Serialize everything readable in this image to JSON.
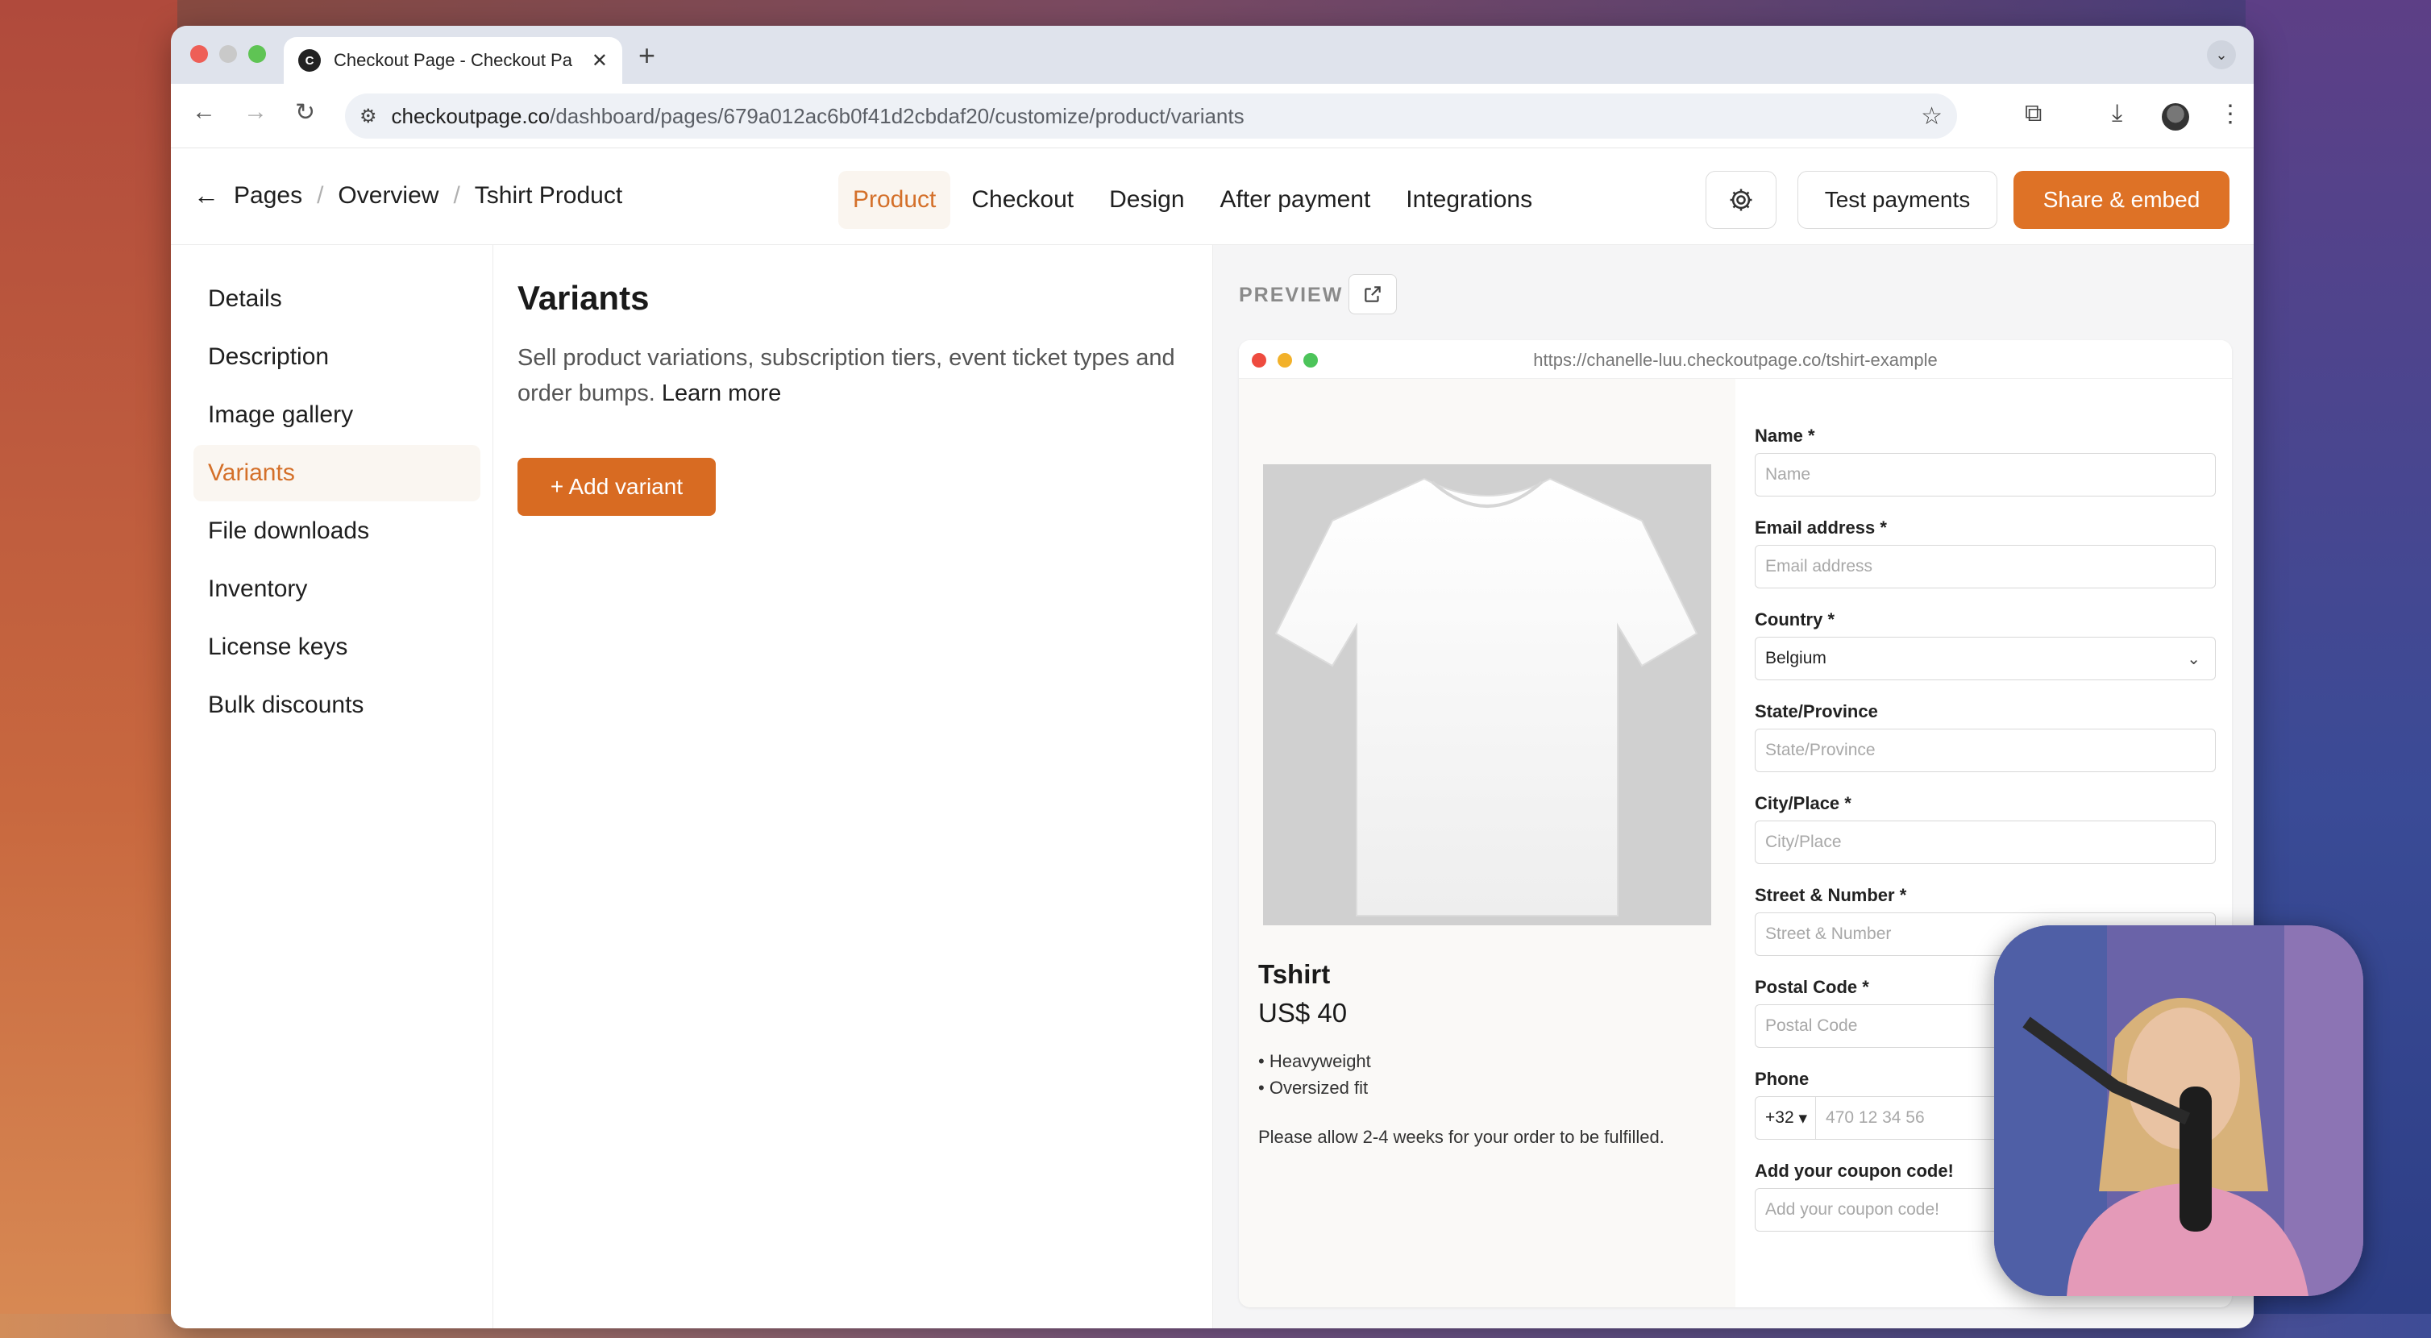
{
  "browser": {
    "tab_title": "Checkout Page - Checkout Pa",
    "tab_favicon": "C",
    "url_domain": "checkoutpage.co",
    "url_path": "/dashboard/pages/679a012ac6b0f41d2cbdaf20/customize/product/variants"
  },
  "header": {
    "breadcrumbs": [
      "Pages",
      "Overview",
      "Tshirt Product"
    ],
    "tabs": [
      "Product",
      "Checkout",
      "Design",
      "After payment",
      "Integrations"
    ],
    "active_tab": "Product",
    "test_payments": "Test payments",
    "share_embed": "Share & embed",
    "accent": "#de7226"
  },
  "sidebar": {
    "items": [
      "Details",
      "Description",
      "Image gallery",
      "Variants",
      "File downloads",
      "Inventory",
      "License keys",
      "Bulk discounts"
    ],
    "active": "Variants"
  },
  "main": {
    "title": "Variants",
    "description": "Sell product variations, subscription tiers, event ticket types and order bumps.",
    "learn_more": "Learn more",
    "add_variant": "+ Add variant"
  },
  "preview": {
    "label": "PREVIEW",
    "url": "https://chanelle-luu.checkoutpage.co/tshirt-example",
    "product": {
      "name": "Tshirt",
      "price": "US$ 40",
      "bullets": [
        "Heavyweight",
        "Oversized fit"
      ],
      "note": "Please allow 2-4 weeks for your order to be fulfilled."
    },
    "form": {
      "name_label": "Name",
      "name_placeholder": "Name",
      "email_label": "Email address",
      "email_placeholder": "Email address",
      "country_label": "Country",
      "country_value": "Belgium",
      "state_label": "State/Province",
      "state_placeholder": "State/Province",
      "city_label": "City/Place",
      "city_placeholder": "City/Place",
      "street_label": "Street & Number",
      "street_placeholder": "Street & Number",
      "postal_label": "Postal Code",
      "postal_placeholder": "Postal Code",
      "phone_label": "Phone",
      "phone_code": "+32",
      "phone_placeholder": "470 12 34 56",
      "coupon_label": "Add your coupon code!",
      "coupon_placeholder": "Add your coupon code!",
      "required_mark": "*"
    }
  }
}
